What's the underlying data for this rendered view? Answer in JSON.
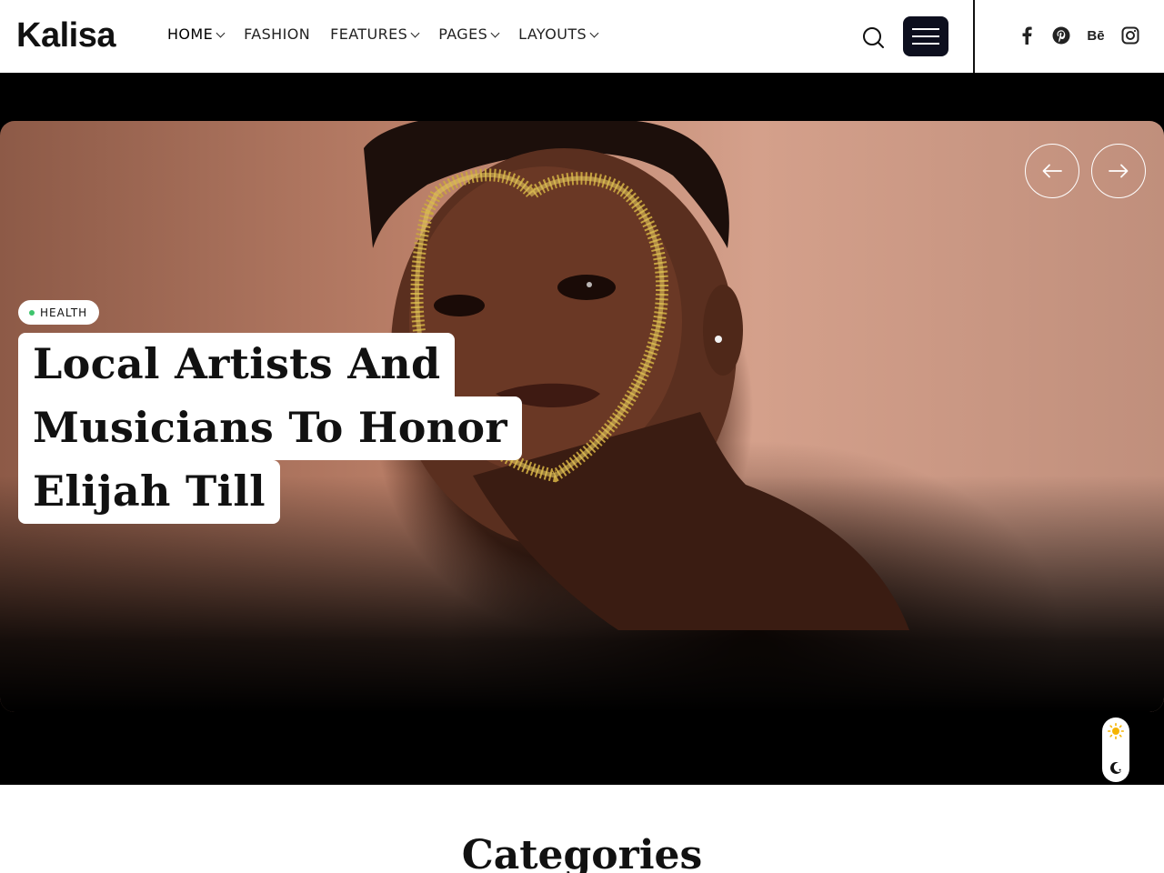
{
  "header": {
    "logo": "Kalisa",
    "nav": [
      {
        "label": "HOME",
        "has_dropdown": true
      },
      {
        "label": "FASHION",
        "has_dropdown": false
      },
      {
        "label": "FEATURES",
        "has_dropdown": true
      },
      {
        "label": "PAGES",
        "has_dropdown": true
      },
      {
        "label": "LAYOUTS",
        "has_dropdown": true
      }
    ],
    "icons": {
      "search": "search-icon",
      "menu": "hamburger-menu-icon"
    },
    "social": [
      {
        "name": "facebook-icon"
      },
      {
        "name": "pinterest-icon"
      },
      {
        "name": "behance-icon",
        "label": "Bē"
      },
      {
        "name": "instagram-icon"
      }
    ]
  },
  "hero": {
    "category": "HEALTH",
    "category_dot_color": "#3ec46d",
    "headline_lines": [
      "Local Artists And",
      "Musicians To Honor",
      "Elijah Till"
    ],
    "controls": {
      "prev": "arrow-left-icon",
      "next": "arrow-right-icon"
    }
  },
  "theme_toggle": {
    "light": "sun-icon",
    "dark": "moon-icon"
  },
  "categories_section": {
    "title": "Categories"
  },
  "colors": {
    "menu_button_bg": "#0d0f1e",
    "hero_bg": "#000000",
    "accent_green": "#3ec46d"
  }
}
